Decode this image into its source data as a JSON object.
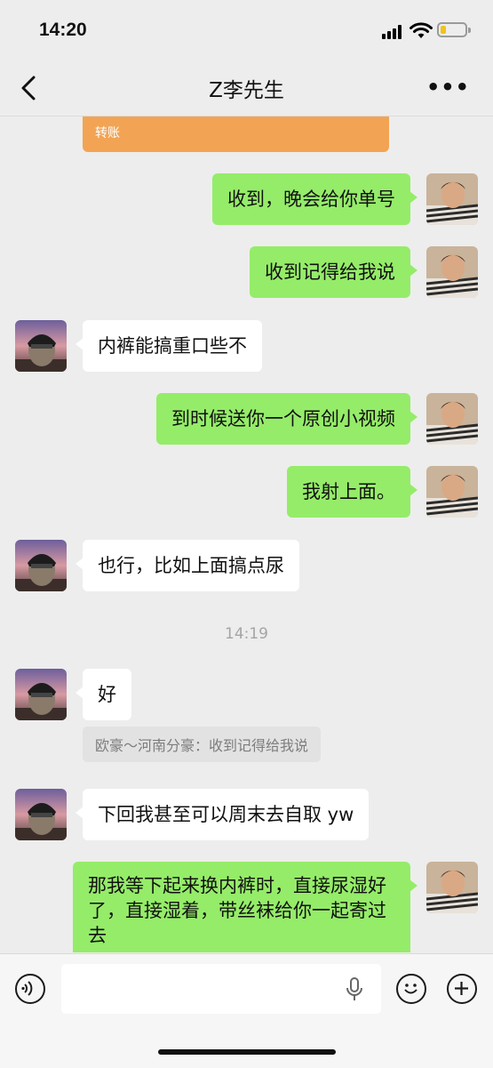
{
  "status": {
    "time": "14:20"
  },
  "header": {
    "title": "Z李先生",
    "back_icon": "chevron-left-icon",
    "more_icon": "more-dots-icon"
  },
  "transfer": {
    "label": "转账",
    "color": "#f2a454"
  },
  "messages": [
    {
      "from": "me",
      "text": "收到，晚会给你单号"
    },
    {
      "from": "me",
      "text": "收到记得给我说"
    },
    {
      "from": "other",
      "text": "内裤能搞重口些不"
    },
    {
      "from": "me",
      "text": "到时候送你一个原创小视频"
    },
    {
      "from": "me",
      "text": "我射上面。"
    },
    {
      "from": "other",
      "text": "也行，比如上面搞点尿"
    },
    {
      "timestamp": "14:19"
    },
    {
      "from": "other",
      "text": "好"
    },
    {
      "quote": "欧豪～河南分豪：收到记得给我说"
    },
    {
      "from": "other",
      "text": "下回我甚至可以周末去自取 yw"
    },
    {
      "from": "me",
      "text": "那我等下起来换内裤时，直接尿湿好了，直接湿着，带丝袜给你一起寄过去"
    }
  ],
  "input_bar": {
    "placeholder": "",
    "voice_icon": "voice-icon",
    "mic_icon": "microphone-icon",
    "emoji_icon": "emoji-icon",
    "plus_icon": "plus-icon"
  },
  "colors": {
    "me_bubble": "#95ec69",
    "other_bubble": "#ffffff",
    "background": "#ededed"
  }
}
